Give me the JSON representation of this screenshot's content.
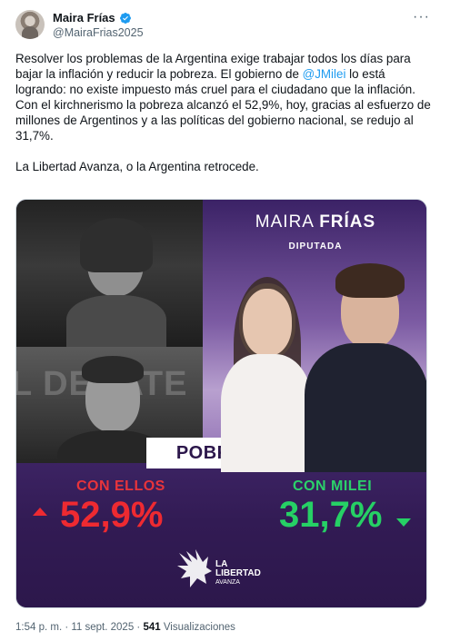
{
  "author": {
    "name": "Maira Frías",
    "handle": "@MairaFrias2025",
    "verified": true,
    "verified_color": "#1d9bf0"
  },
  "tweet": {
    "text_part1": "Resolver los problemas de la Argentina exige trabajar todos los días para bajar la inflación y reducir la pobreza. El gobierno de ",
    "mention": "@JMilei",
    "text_part2": " lo está logrando: no existe impuesto más cruel para el ciudadano que la inflación. Con el kirchnerismo la pobreza alcanzó el 52,9%, hoy, gracias al esfuerzo de millones de Argentinos y a las políticas del gobierno nacional, se redujo al 31,7%.",
    "paragraph2": "La Libertad Avanza, o la Argentina retrocede."
  },
  "media": {
    "candidate_first": "MAIRA",
    "candidate_last": "FRÍAS",
    "candidate_role": "DIPUTADA",
    "background_letters": "L DEBATE",
    "headline": "POBREZA",
    "left_label": "CON ELLOS",
    "left_value": "52,9%",
    "right_label": "CON MILEI",
    "right_value": "31,7%",
    "logo_line1": "LA",
    "logo_line2": "LIBERTAD",
    "logo_line3": "AVANZA",
    "colors": {
      "red": "#ee2a31",
      "green": "#26d065",
      "purple": "#2c174b"
    }
  },
  "footer": {
    "time": "1:54 p. m.",
    "separator": " · ",
    "date": "11 sept. 2025",
    "views": "541",
    "views_label": "Visualizaciones"
  },
  "icons": {
    "more": "more-options-icon",
    "verified": "verified-badge-icon",
    "arrow_up": "arrow-up-icon",
    "arrow_down": "arrow-down-icon"
  }
}
